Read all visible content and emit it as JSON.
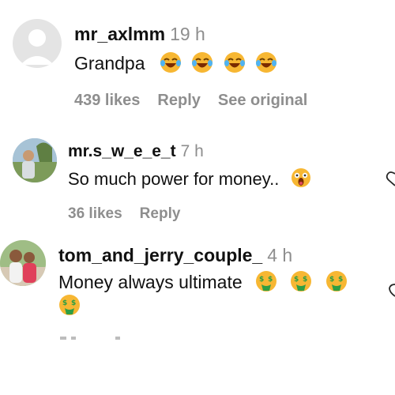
{
  "comments": [
    {
      "username": "mr_axlmm",
      "time": "19 h",
      "text": "Grandpa",
      "reactions": [
        "face-with-tears-of-joy",
        "face-with-tears-of-joy",
        "face-with-tears-of-joy",
        "face-with-tears-of-joy"
      ],
      "likes": "439 likes",
      "reply": "Reply",
      "see_original": "See original",
      "avatar": "default-avatar"
    },
    {
      "username": "mr.s_w_e_e_t",
      "time": "7 h",
      "text": "So much power for money..",
      "reactions": [
        "face-screaming-in-fear"
      ],
      "likes": "36 likes",
      "reply": "Reply",
      "avatar": "photo-avatar"
    },
    {
      "username": "tom_and_jerry_couple_",
      "time": "4 h",
      "text": "Money always ultimate",
      "reactions": [
        "money-mouth-face",
        "money-mouth-face",
        "money-mouth-face",
        "money-mouth-face"
      ],
      "avatar": "photo-avatar"
    }
  ],
  "colors": {
    "meta_gray": "#8e8e8e",
    "emoji_yellow": "#f7b733",
    "money_green": "#2e9e44"
  }
}
